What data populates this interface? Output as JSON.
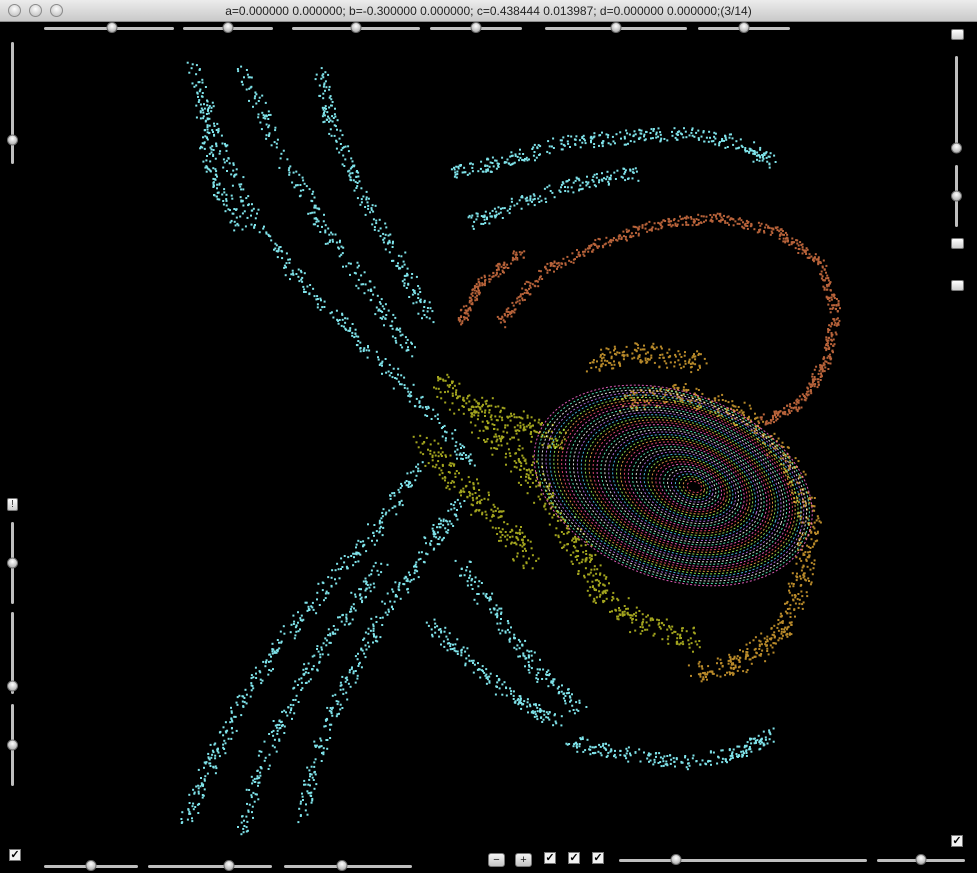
{
  "window": {
    "title": "a=0.000000 0.000000; b=-0.300000 0.000000; c=0.438444 0.013987; d=0.000000 0.000000;(3/14)"
  },
  "colors": {
    "background": "#000000",
    "cyan": "#7fe3ea",
    "rust": "#b8633a",
    "olive": "#a3a51e",
    "amber": "#b98a2a",
    "spiral": [
      "#ff6ad5",
      "#66ffcc",
      "#ffffff",
      "#c77dff",
      "#4dd2ff",
      "#a0ff5a",
      "#ffb04d",
      "#ff4f7a"
    ]
  },
  "icons": {
    "close": "close-icon",
    "minimize": "minimize-icon",
    "zoom": "zoom-icon",
    "checkmark": "✓",
    "exclamation": "!"
  },
  "controls": {
    "top_sliders": [
      {
        "name": "slider-top-1",
        "value": 0.52
      },
      {
        "name": "slider-top-2",
        "value": 0.5
      },
      {
        "name": "slider-top-3",
        "value": 0.5
      },
      {
        "name": "slider-top-4",
        "value": 0.5
      },
      {
        "name": "slider-top-5",
        "value": 0.5
      },
      {
        "name": "slider-top-6",
        "value": 0.5
      }
    ],
    "bottom_sliders": [
      {
        "name": "slider-bottom-1",
        "value": 0.5
      },
      {
        "name": "slider-bottom-2",
        "value": 0.65
      },
      {
        "name": "slider-bottom-3",
        "value": 0.45
      },
      {
        "name": "slider-bottom-4",
        "value": 0.23
      },
      {
        "name": "slider-bottom-5",
        "value": 0.5
      }
    ],
    "left_sliders": [
      {
        "name": "slider-left-1",
        "value": 0.8
      },
      {
        "name": "slider-left-2",
        "value": 0.5
      },
      {
        "name": "slider-left-3",
        "value": 0.9
      },
      {
        "name": "slider-left-4",
        "value": 0.5
      }
    ],
    "right_sliders": [
      {
        "name": "slider-right-1",
        "value": 0.96
      },
      {
        "name": "slider-right-2",
        "value": 0.5
      }
    ],
    "zoom_out_label": "−",
    "zoom_in_label": "+",
    "exclamation_label": "!",
    "checkbox_mark": "✓"
  }
}
